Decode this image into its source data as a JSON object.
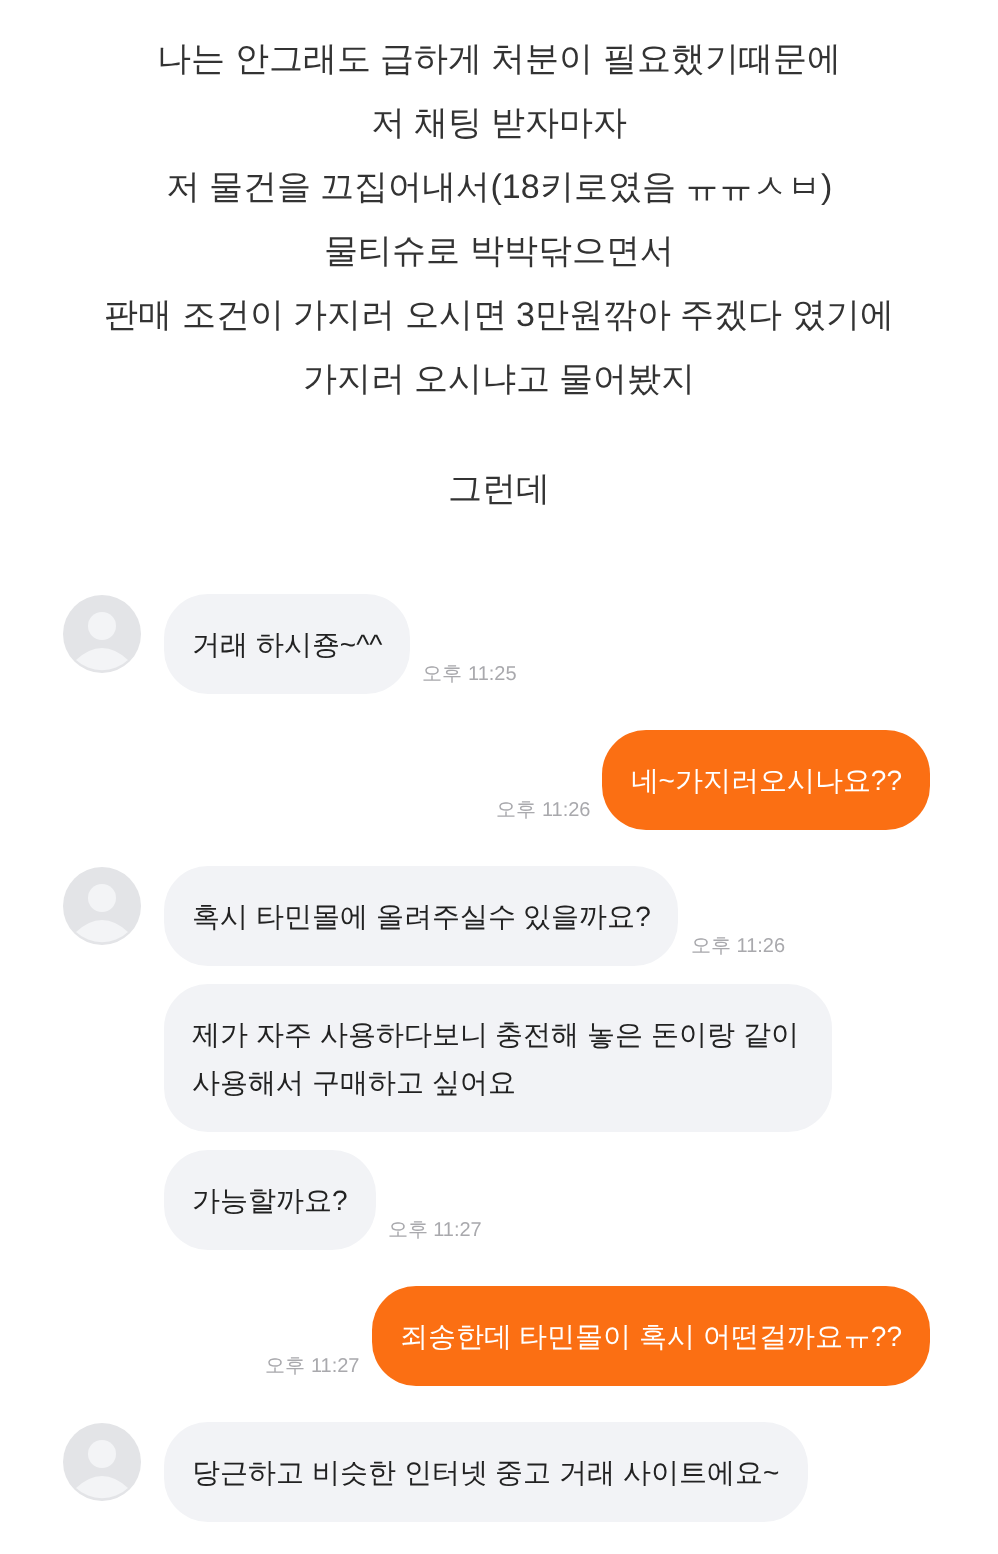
{
  "caption": {
    "lines": [
      "나는 안그래도 급하게 처분이 필요했기때문에",
      "저 채팅 받자마자",
      "저 물건을 끄집어내서(18키로였음 ㅠㅠㅅㅂ)",
      "물티슈로 박박닦으면서",
      "판매 조건이 가지러 오시면 3만원깎아 주겠다 였기에",
      "가지러 오시냐고 물어봤지"
    ],
    "after": "그런데"
  },
  "messages": [
    {
      "kind": "incoming",
      "avatar": true,
      "text": "거래 하시죵~^^",
      "time": "오후 11:25"
    },
    {
      "kind": "outgoing",
      "text": "네~가지러오시나요??",
      "time": "오후 11:26"
    },
    {
      "kind": "incoming",
      "avatar": true,
      "text": "혹시 타민몰에 올려주실수 있을까요?",
      "time": "오후 11:26"
    },
    {
      "kind": "incoming",
      "avatar": false,
      "text": "제가 자주 사용하다보니 충전해 놓은 돈이랑 같이 사용해서 구매하고 싶어요"
    },
    {
      "kind": "incoming",
      "avatar": false,
      "text": "가능할까요?",
      "time": "오후 11:27"
    },
    {
      "kind": "outgoing",
      "text": "죄송한데 타민몰이 혹시 어떤걸까요ㅠ??",
      "time": "오후 11:27"
    },
    {
      "kind": "incoming",
      "avatar": true,
      "text": "당근하고 비슷한 인터넷 중고 거래 사이트에요~"
    }
  ]
}
